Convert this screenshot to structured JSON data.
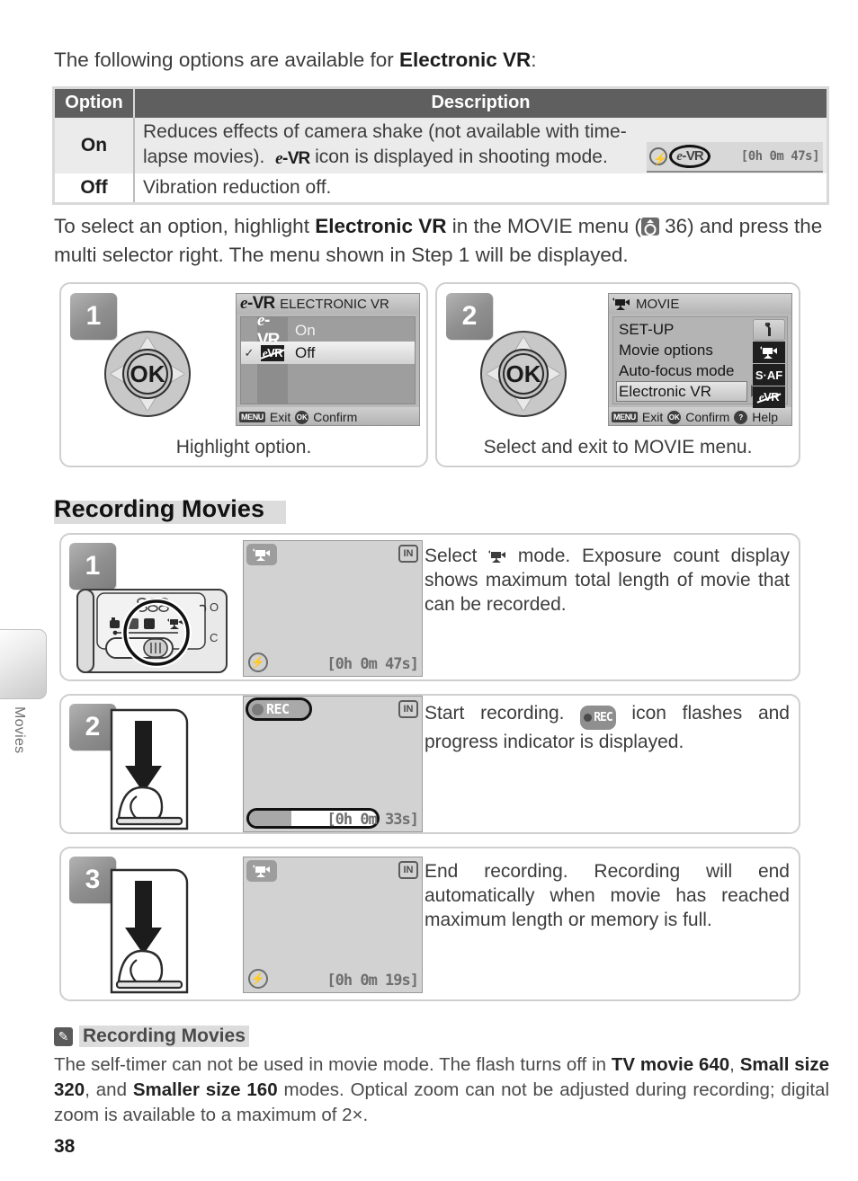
{
  "side_tab": {
    "label": "Movies"
  },
  "intro": {
    "before": "The following options are available for ",
    "bold": "Electronic VR",
    "after": ":"
  },
  "options_table": {
    "headers": {
      "option": "Option",
      "description": "Description"
    },
    "rows": [
      {
        "option": "On",
        "desc_line1": "Reduces effects of camera shake (not available with time-",
        "desc_line2_a": "lapse movies).",
        "desc_icon": "e-VR",
        "desc_line2_b": "icon is displayed in shooting mode.",
        "mini_lcd": {
          "flash_icon": "flash-icon",
          "vr_icon": "e-VR",
          "counter": "[0h 0m 47s]"
        }
      },
      {
        "option": "Off",
        "desc_line1": "Vibration reduction off."
      }
    ]
  },
  "paragraph": {
    "p1a": "To select an option, highlight ",
    "p1b": "Electronic VR",
    "p1c": " in the MOVIE menu (",
    "page_ref": "36",
    "p1d": ") and press the multi selector right.  The menu shown in Step 1 will be displayed."
  },
  "vr_steps": [
    {
      "number": "1",
      "caption": "Highlight option.",
      "screen": {
        "title_icon": "e-VR",
        "title": "ELECTRONIC VR",
        "items": [
          {
            "check": "",
            "icon": "e-VR",
            "label": "On",
            "selected": false
          },
          {
            "check": "✓",
            "icon": "e-VR-off",
            "label": "Off",
            "selected": true
          }
        ],
        "footer": [
          {
            "key": "MENU",
            "label": "Exit"
          },
          {
            "key": "OK",
            "label": "Confirm"
          }
        ]
      }
    },
    {
      "number": "2",
      "caption": "Select and exit to MOVIE menu.",
      "screen": {
        "title_icon": "movie-camera-icon",
        "title": "MOVIE",
        "items": [
          {
            "label": "SET-UP",
            "selected": false
          },
          {
            "label": "Movie options",
            "selected": false
          },
          {
            "label": "Auto-focus mode",
            "selected": false
          },
          {
            "label": "Electronic VR",
            "selected": true
          }
        ],
        "side_icons": [
          "wrench-icon",
          "movie-camera-icon",
          "S·AF",
          "e-VR-off"
        ],
        "footer": [
          {
            "key": "MENU",
            "label": "Exit"
          },
          {
            "key": "OK",
            "label": "Confirm"
          },
          {
            "key": "?",
            "label": "Help"
          }
        ]
      }
    }
  ],
  "section": {
    "title": "Recording Movies"
  },
  "rec_steps": [
    {
      "number": "1",
      "illustration": "camera-mode-dial",
      "screen": {
        "mode_icon": "movie-camera-icon",
        "memory_icon": "IN",
        "flash_icon": "flash-off-icon",
        "counter": "[0h 0m 47s]"
      },
      "text_a": "Select ",
      "text_icon": "movie-camera-icon",
      "text_b": " mode.  Exposure count display shows maximum total length of movie that can be recorded."
    },
    {
      "number": "2",
      "illustration": "finger-press-shutter",
      "screen": {
        "rec_label": "REC",
        "memory_icon": "IN",
        "counter": "[0h 0m 33s]",
        "progress_percent": 33
      },
      "text_a": "Start recording.  ",
      "text_icon": "REC",
      "text_b": " icon flashes and progress indicator is displayed."
    },
    {
      "number": "3",
      "illustration": "finger-press-shutter",
      "screen": {
        "mode_icon": "movie-camera-icon",
        "memory_icon": "IN",
        "flash_icon": "flash-off-icon",
        "counter": "[0h 0m 19s]"
      },
      "text_a": "End recording.  Recording will end automatically when movie has reached maximum length or memory is full.",
      "text_icon": "",
      "text_b": ""
    }
  ],
  "note": {
    "icon": "pencil-icon",
    "title": "Recording Movies",
    "t1": "The self-timer can not be used in movie mode.  The flash turns off in ",
    "b1": "TV movie 640",
    "t2": ", ",
    "b2": "Small size 320",
    "t3": ", and ",
    "b3": "Smaller size 160",
    "t4": " modes.  Optical zoom can not be adjusted during recording; digital zoom is available to a maximum of 2×."
  },
  "page_number": "38",
  "colors": {
    "header_gray": "#5f5f5f",
    "row_on": "#ebebeb",
    "panel_border": "#cfcfcf",
    "badge_gray": "#909090",
    "lcd_gray": "#d2d2d2",
    "band_gray": "#dcdcdc"
  }
}
